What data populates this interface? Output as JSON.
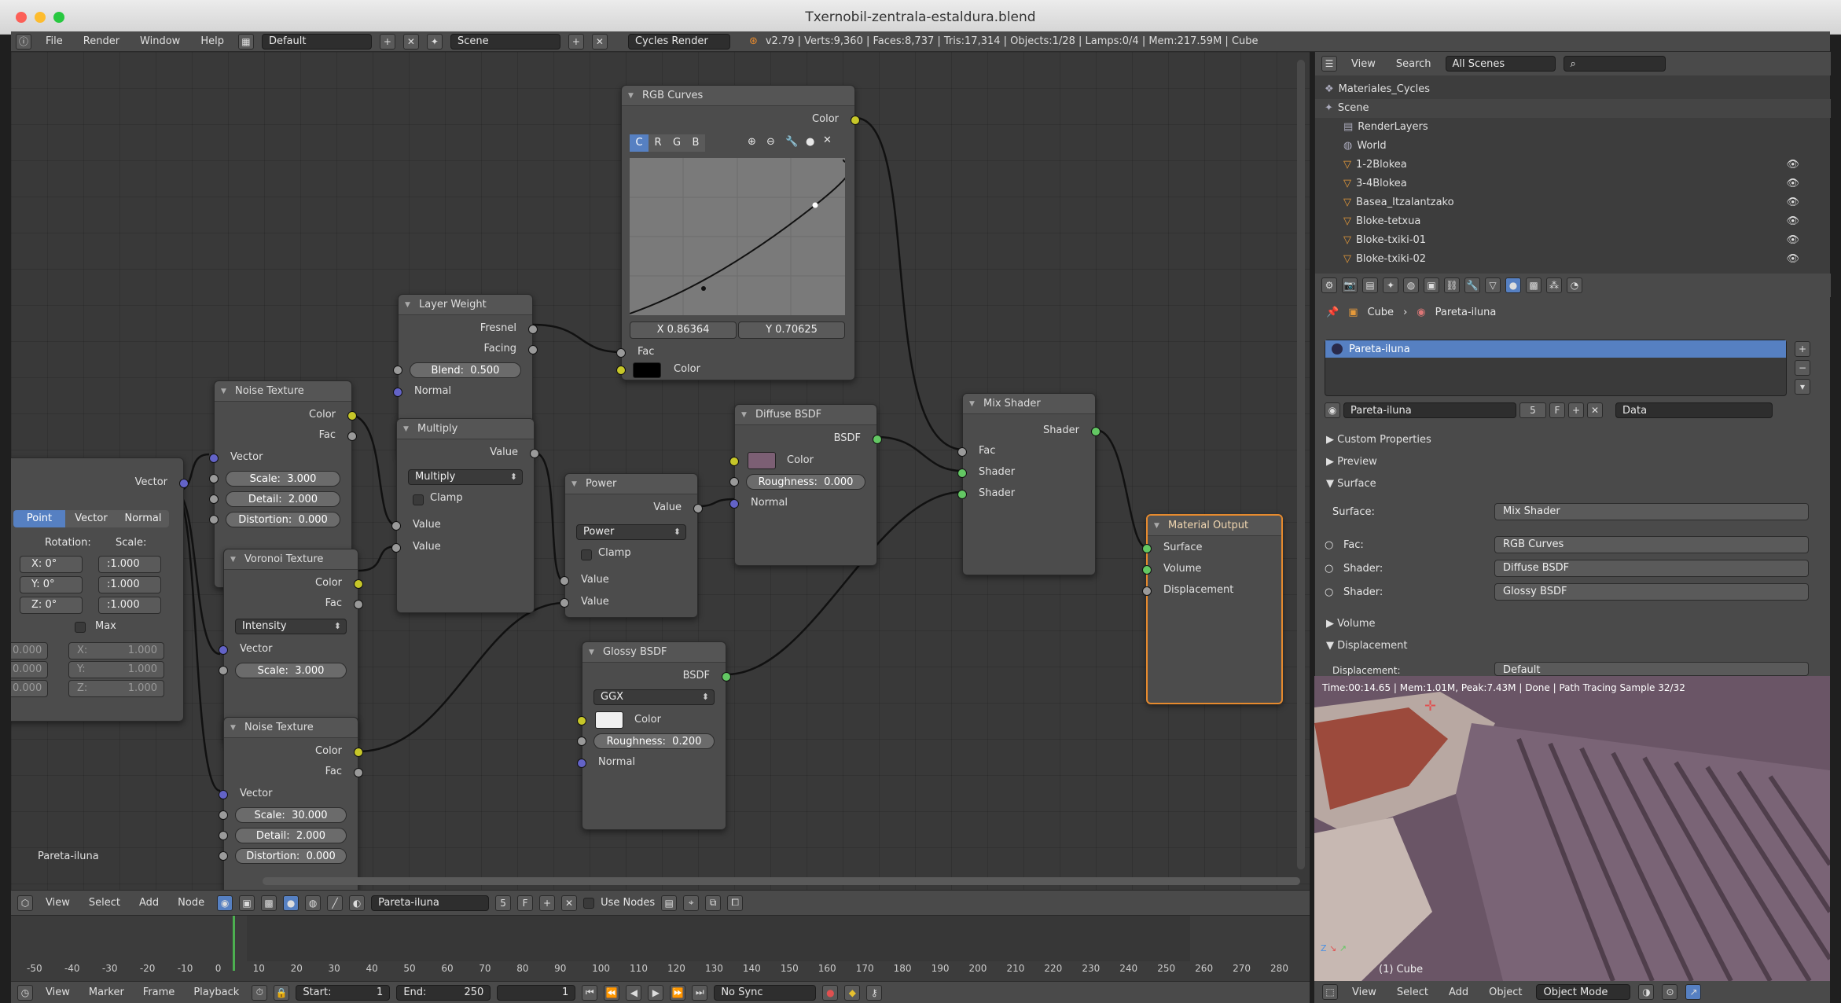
{
  "window": {
    "title": "Txernobil-zentrala-estaldura.blend"
  },
  "info_header": {
    "menus": [
      "File",
      "Render",
      "Window",
      "Help"
    ],
    "layout": "Default",
    "scene": "Scene",
    "engine": "Cycles Render",
    "stats": "v2.79 | Verts:9,360 | Faces:8,737 | Tris:17,314 | Objects:1/28 | Lamps:0/4 | Mem:217.59M | Cube"
  },
  "nodes": {
    "rgb_curves": {
      "title": "RGB Curves",
      "out": "Color",
      "channels": [
        "C",
        "R",
        "G",
        "B"
      ],
      "x_val": "X 0.86364",
      "y_val": "Y 0.70625",
      "in_fac": "Fac",
      "in_color": "Color"
    },
    "layer_weight": {
      "title": "Layer Weight",
      "out1": "Fresnel",
      "out2": "Facing",
      "blend": "Blend:",
      "blend_val": "0.500",
      "in": "Normal"
    },
    "noise1": {
      "title": "Noise Texture",
      "out1": "Color",
      "out2": "Fac",
      "in": "Vector",
      "scale": "Scale:",
      "scale_val": "3.000",
      "detail": "Detail:",
      "detail_val": "2.000",
      "distortion": "Distortion:",
      "distortion_val": "0.000"
    },
    "multiply": {
      "title": "Multiply",
      "out": "Value",
      "op": "Multiply",
      "clamp": "Clamp",
      "in1": "Value",
      "in2": "Value"
    },
    "power": {
      "title": "Power",
      "out": "Value",
      "op": "Power",
      "clamp": "Clamp",
      "in1": "Value",
      "in2": "Value"
    },
    "diffuse": {
      "title": "Diffuse BSDF",
      "out": "BSDF",
      "color": "Color",
      "roughness": "Roughness:",
      "roughness_val": "0.000",
      "normal": "Normal"
    },
    "mix": {
      "title": "Mix Shader",
      "out": "Shader",
      "fac": "Fac",
      "s1": "Shader",
      "s2": "Shader"
    },
    "output": {
      "title": "Material Output",
      "surface": "Surface",
      "volume": "Volume",
      "displacement": "Displacement"
    },
    "voronoi": {
      "title": "Voronoi Texture",
      "out1": "Color",
      "out2": "Fac",
      "mode": "Intensity",
      "in": "Vector",
      "scale": "Scale:",
      "scale_val": "3.000"
    },
    "glossy": {
      "title": "Glossy BSDF",
      "out": "BSDF",
      "dist": "GGX",
      "color": "Color",
      "roughness": "Roughness:",
      "roughness_val": "0.200",
      "normal": "Normal"
    },
    "noise2": {
      "title": "Noise Texture",
      "out1": "Color",
      "out2": "Fac",
      "in": "Vector",
      "scale": "Scale:",
      "scale_val": "30.000",
      "detail": "Detail:",
      "detail_val": "2.000",
      "distortion": "Distortion:",
      "distortion_val": "0.000"
    },
    "mapping": {
      "out": "Vector",
      "tabs": [
        "Point",
        "Vector",
        "Normal"
      ],
      "rotation": "Rotation:",
      "scale": "Scale:",
      "rx": "X:",
      "rx_val": "0°",
      "ry": "Y:",
      "ry_val": "0°",
      "rz": "Z:",
      "rz_val": "0°",
      "sx": ":1.000",
      "sy": ":1.000",
      "sz": ":1.000",
      "max": "Max",
      "min_vals": [
        "0.000",
        "0.000",
        "0.000"
      ],
      "max_x": "X:",
      "max_y": "Y:",
      "max_z": "Z:",
      "max_vals": [
        "1.000",
        "1.000",
        "1.000"
      ]
    }
  },
  "node_editor": {
    "material_label": "Pareta-iluna",
    "header": {
      "menus": [
        "View",
        "Select",
        "Add",
        "Node"
      ],
      "material": "Pareta-iluna",
      "users": "5",
      "fake": "F",
      "use_nodes": "Use Nodes"
    }
  },
  "outliner": {
    "menus": [
      "View",
      "Search"
    ],
    "filter": "All Scenes",
    "items": [
      "Materiales_Cycles",
      "Scene",
      "RenderLayers",
      "World",
      "1-2Blokea",
      "3-4Blokea",
      "Basea_Itzalantzako",
      "Bloke-tetxua",
      "Bloke-txiki-01",
      "Bloke-txiki-02"
    ]
  },
  "properties": {
    "breadcrumb": [
      "Cube",
      "Pareta-iluna"
    ],
    "slot": "Pareta-iluna",
    "material": "Pareta-iluna",
    "users": "5",
    "fake": "F",
    "link": "Data",
    "panels": {
      "custom": "Custom Properties",
      "preview": "Preview",
      "surface": "Surface",
      "volume": "Volume",
      "displacement": "Displacement"
    },
    "surface_label": "Surface:",
    "surface_val": "Mix Shader",
    "fac_label": "Fac:",
    "fac_val": "RGB Curves",
    "shader1_label": "Shader:",
    "shader1_val": "Diffuse BSDF",
    "shader2_label": "Shader:",
    "shader2_val": "Glossy BSDF",
    "disp_label": "Displacement:",
    "disp_val": "Default"
  },
  "viewport": {
    "status": "Time:00:14.65 | Mem:1.01M, Peak:7.43M | Done | Path Tracing Sample 32/32",
    "object": "(1) Cube",
    "menus": [
      "View",
      "Select",
      "Add",
      "Object"
    ],
    "mode": "Object Mode"
  },
  "timeline": {
    "ticks": [
      "-50",
      "-40",
      "-30",
      "-20",
      "-10",
      "0",
      "10",
      "20",
      "30",
      "40",
      "50",
      "60",
      "70",
      "80",
      "90",
      "100",
      "110",
      "120",
      "130",
      "140",
      "150",
      "160",
      "170",
      "180",
      "190",
      "200",
      "210",
      "220",
      "230",
      "240",
      "250",
      "260",
      "270",
      "280"
    ],
    "menus": [
      "View",
      "Marker",
      "Frame",
      "Playback"
    ],
    "start_label": "Start:",
    "start": "1",
    "end_label": "End:",
    "end": "250",
    "current": "1",
    "sync": "No Sync"
  },
  "colors": {
    "accent": "#5680c2",
    "selected_node_border": "#e68a2e",
    "socket_color": "#c7c729",
    "socket_shader": "#63c763",
    "socket_vector": "#6363c7",
    "socket_value": "#9a9a9a"
  }
}
